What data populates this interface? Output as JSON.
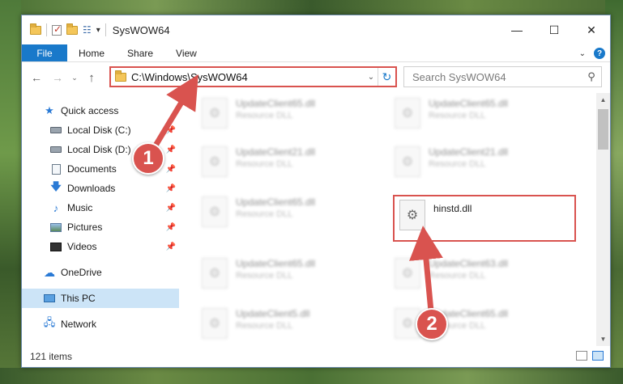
{
  "window": {
    "title": "SysWOW64",
    "minimize": "—",
    "maximize": "☐",
    "close": "✕"
  },
  "ribbon": {
    "file": "File",
    "tabs": [
      "Home",
      "Share",
      "View"
    ]
  },
  "navigation": {
    "back": "←",
    "forward": "→",
    "recent": "⌄",
    "up": "↑",
    "address": "C:\\Windows\\SysWOW64",
    "search_placeholder": "Search SysWOW64"
  },
  "sidebar": {
    "quick_access": "Quick access",
    "items": [
      {
        "label": "Local Disk (C:)",
        "icon": "disk-icon"
      },
      {
        "label": "Local Disk (D:)",
        "icon": "disk-icon"
      },
      {
        "label": "Documents",
        "icon": "documents-icon"
      },
      {
        "label": "Downloads",
        "icon": "downloads-icon"
      },
      {
        "label": "Music",
        "icon": "music-icon"
      },
      {
        "label": "Pictures",
        "icon": "pictures-icon"
      },
      {
        "label": "Videos",
        "icon": "videos-icon"
      }
    ],
    "onedrive": "OneDrive",
    "this_pc": "This PC",
    "network": "Network"
  },
  "files": [
    {
      "name": "UpdateClient65.dll",
      "type": "Resource DLL"
    },
    {
      "name": "UpdateClient65.dll",
      "type": "Resource DLL"
    },
    {
      "name": "UpdateClient21.dll",
      "type": "Resource DLL"
    },
    {
      "name": "UpdateClient21.dll",
      "type": "Resource DLL"
    },
    {
      "name": "UpdateClient65.dll",
      "type": "Resource DLL"
    },
    {
      "name": "hinstd.dll",
      "type": ""
    },
    {
      "name": "UpdateClient65.dll",
      "type": "Resource DLL"
    },
    {
      "name": "UpdateClient63.dll",
      "type": "Resource DLL"
    },
    {
      "name": "UpdateClient5.dll",
      "type": "Resource DLL"
    },
    {
      "name": "UpdateClient65.dll",
      "type": "Resource DLL"
    }
  ],
  "status": {
    "items_count": "121 items"
  },
  "callouts": {
    "step1": "1",
    "step2": "2"
  },
  "colors": {
    "accent": "#1979ca",
    "highlight": "#d9534f",
    "selected": "#cce4f7"
  }
}
